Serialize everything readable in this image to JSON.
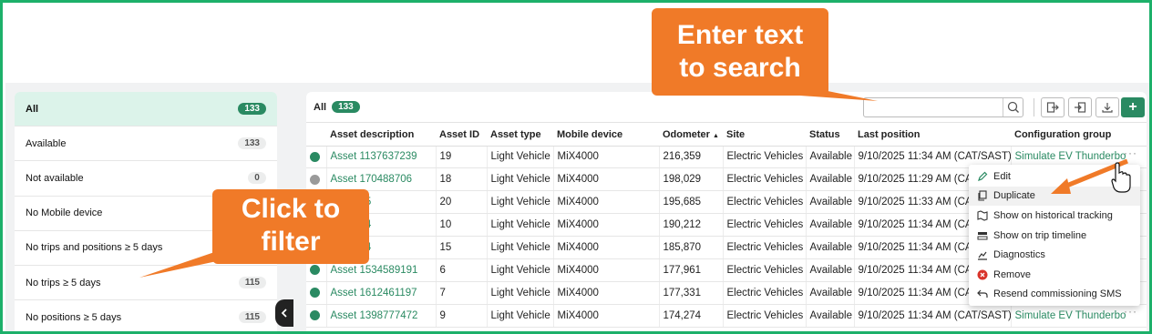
{
  "colors": {
    "accent": "#2a8a62",
    "border": "#1db06a",
    "callout": "#f07a28"
  },
  "sidebar": {
    "items": [
      {
        "label": "All",
        "count": "133"
      },
      {
        "label": "Available",
        "count": "133"
      },
      {
        "label": "Not available",
        "count": "0"
      },
      {
        "label": "No Mobile device",
        "count": ""
      },
      {
        "label": "No trips and positions ≥ 5 days",
        "count": ""
      },
      {
        "label": "No trips ≥ 5 days",
        "count": "115"
      },
      {
        "label": "No positions ≥ 5 days",
        "count": "115"
      }
    ],
    "collapse_icon": "chevron-left-icon"
  },
  "toolbar": {
    "title": "All",
    "count": "133",
    "search_placeholder": "",
    "add_label": "+"
  },
  "table": {
    "columns": [
      "",
      "Asset description",
      "Asset ID",
      "Asset type",
      "Mobile device",
      "Odometer",
      "Site",
      "Status",
      "Last position",
      "Configuration group"
    ],
    "sort_indicator": "▲",
    "rows": [
      {
        "status": "green",
        "desc": "Asset 1137637239",
        "id": "19",
        "type": "Light Vehicle",
        "device": "MiX4000",
        "odometer": "216,359",
        "site": "Electric Vehicles",
        "status_text": "Available",
        "last_position": "9/10/2025 11:34 AM (CAT/SAST)",
        "config": "Simulate EV Thunderbo"
      },
      {
        "status": "grey",
        "desc": "Asset 170488706",
        "id": "18",
        "type": "Light Vehicle",
        "device": "MiX4000",
        "odometer": "198,029",
        "site": "Electric Vehicles",
        "status_text": "Available",
        "last_position": "9/10/2025 11:29 AM (CAT/SAST)",
        "config": ""
      },
      {
        "status": "green",
        "desc": "0292135",
        "id": "20",
        "type": "Light Vehicle",
        "device": "MiX4000",
        "odometer": "195,685",
        "site": "Electric Vehicles",
        "status_text": "Available",
        "last_position": "9/10/2025 11:33 AM (CAT/SAST)",
        "config": ""
      },
      {
        "status": "green",
        "desc": "0317744",
        "id": "10",
        "type": "Light Vehicle",
        "device": "MiX4000",
        "odometer": "190,212",
        "site": "Electric Vehicles",
        "status_text": "Available",
        "last_position": "9/10/2025 11:34 AM (CAT/SAST)",
        "config": ""
      },
      {
        "status": "green",
        "desc": "1883494",
        "id": "15",
        "type": "Light Vehicle",
        "device": "MiX4000",
        "odometer": "185,870",
        "site": "Electric Vehicles",
        "status_text": "Available",
        "last_position": "9/10/2025 11:34 AM (CAT/SAST)",
        "config": ""
      },
      {
        "status": "green",
        "desc": "Asset 1534589191",
        "id": "6",
        "type": "Light Vehicle",
        "device": "MiX4000",
        "odometer": "177,961",
        "site": "Electric Vehicles",
        "status_text": "Available",
        "last_position": "9/10/2025 11:34 AM (CAT/SAST)",
        "config": ""
      },
      {
        "status": "green",
        "desc": "Asset 1612461197",
        "id": "7",
        "type": "Light Vehicle",
        "device": "MiX4000",
        "odometer": "177,331",
        "site": "Electric Vehicles",
        "status_text": "Available",
        "last_position": "9/10/2025 11:34 AM (CAT/SAST)",
        "config": ""
      },
      {
        "status": "green",
        "desc": "Asset 1398777472",
        "id": "9",
        "type": "Light Vehicle",
        "device": "MiX4000",
        "odometer": "174,274",
        "site": "Electric Vehicles",
        "status_text": "Available",
        "last_position": "9/10/2025 11:34 AM (CAT/SAST)",
        "config": "Simulate EV Thunderbo"
      }
    ]
  },
  "context_menu": {
    "items": [
      {
        "label": "Edit",
        "icon": "pencil-icon"
      },
      {
        "label": "Duplicate",
        "icon": "copy-icon"
      },
      {
        "label": "Show on historical tracking",
        "icon": "map-icon"
      },
      {
        "label": "Show on trip timeline",
        "icon": "timeline-icon"
      },
      {
        "label": "Diagnostics",
        "icon": "chart-icon"
      },
      {
        "label": "Remove",
        "icon": "remove-icon"
      },
      {
        "label": "Resend commissioning SMS",
        "icon": "resend-icon"
      }
    ]
  },
  "annotations": {
    "search_callout": [
      "Enter text",
      "to search"
    ],
    "filter_callout": [
      "Click to",
      "filter"
    ]
  }
}
